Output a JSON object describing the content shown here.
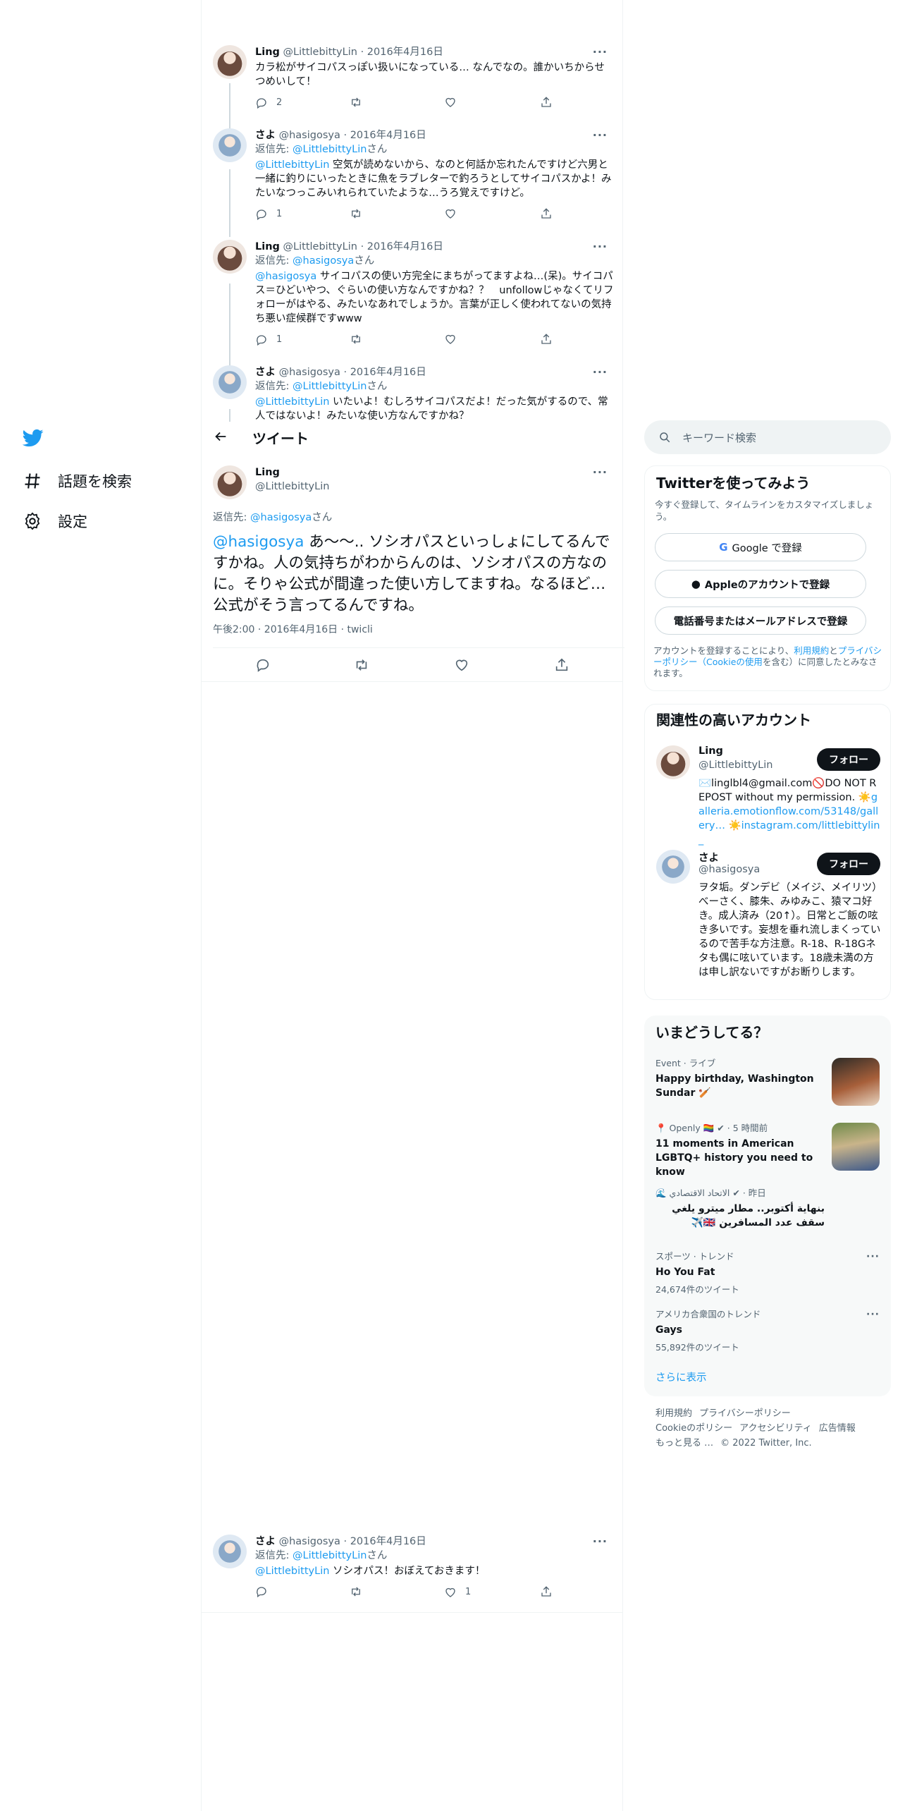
{
  "nav": {
    "explore_label": "話題を検索",
    "settings_label": "設定"
  },
  "thread": [
    {
      "name": "Ling",
      "handle": "@LittlebittyLin",
      "date": "· 2016年4月16日",
      "reply_prefix": "",
      "reply_to": "",
      "reply_suffix": "",
      "mention": "",
      "text": "カラ松がサイコパスっぽい扱いになっている… なんでなの。誰かいちからせつめいして！",
      "replies": "2",
      "retweets": "",
      "likes": ""
    },
    {
      "name": "さよ",
      "handle": "@hasigosya",
      "date": "· 2016年4月16日",
      "reply_prefix": "返信先: ",
      "reply_to": "@LittlebittyLin",
      "reply_suffix": "さん",
      "mention": "@LittlebittyLin",
      "text": " 空気が読めないから、なのと何話か忘れたんですけど六男と一緒に釣りにいったときに魚をラブレターで釣ろうとしてサイコパスかよ！みたいなつっこみいれられていたような…うろ覚えですけど。",
      "replies": "1",
      "retweets": "",
      "likes": ""
    },
    {
      "name": "Ling",
      "handle": "@LittlebittyLin",
      "date": "· 2016年4月16日",
      "reply_prefix": "返信先: ",
      "reply_to": "@hasigosya",
      "reply_suffix": "さん",
      "mention": "@hasigosya",
      "text": " サイコパスの使い方完全にまちがってますよね…(呆)。サイコパス＝ひどいやつ、ぐらいの使い方なんですかね？？　unfollowじゃなくてリフォローがはやる、みたいなあれでしょうか。言葉が正しく使われてないの気持ち悪い症候群ですwww",
      "replies": "1",
      "retweets": "",
      "likes": ""
    },
    {
      "name": "さよ",
      "handle": "@hasigosya",
      "date": "· 2016年4月16日",
      "reply_prefix": "返信先: ",
      "reply_to": "@LittlebittyLin",
      "reply_suffix": "さん",
      "mention": "@LittlebittyLin",
      "text": " いたいよ！むしろサイコパスだよ！だった気がするので、常人ではないよ！みたいな使い方なんですかね？",
      "replies": "",
      "retweets": "",
      "likes": ""
    }
  ],
  "main": {
    "header_title": "ツイート",
    "name": "Ling",
    "handle": "@LittlebittyLin",
    "reply_prefix": "返信先: ",
    "reply_to": "@hasigosya",
    "reply_suffix": "さん",
    "mention": "@hasigosya",
    "text": " あ〜〜.. ソシオパスといっしょにしてるんですかね。人の気持ちがわからんのは、ソシオパスの方なのに。そりゃ公式が間違った使い方してますね。なるほど…公式がそう言ってるんですね。",
    "timestamp": "午後2:00 · 2016年4月16日 · twicli"
  },
  "last_reply": {
    "name": "さよ",
    "handle": "@hasigosya",
    "date": "· 2016年4月16日",
    "reply_prefix": "返信先: ",
    "reply_to": "@LittlebittyLin",
    "reply_suffix": "さん",
    "mention": "@LittlebittyLin",
    "text": " ソシオパス！おぼえておきます！",
    "likes": "1"
  },
  "search": {
    "placeholder": "キーワード検索"
  },
  "signup": {
    "title": "Twitterを使ってみよう",
    "subtitle": "今すぐ登録して、タイムラインをカスタマイズしましょう。",
    "google_label": "Google で登録",
    "apple_label": "Appleのアカウントで登録",
    "phone_label": "電話番号またはメールアドレスで登録",
    "terms_pre": "アカウントを登録することにより、",
    "terms_link1": "利用規約",
    "terms_mid": "と",
    "terms_link2": "プライバシーポリシー（Cookieの使用",
    "terms_post": "を含む）に同意したとみなされます。"
  },
  "related": {
    "title": "関連性の高いアカウント",
    "follow_label": "フォロー",
    "accounts": [
      {
        "name": "Ling",
        "handle": "@LittlebittyLin",
        "bio_a": "✉️linglbl4@gmail.com🚫DO NOT REPOST without my permission. ☀️",
        "bio_link1": "galleria.emotionflow.com/53148/gallery…",
        "bio_b": " ☀️",
        "bio_link2": "instagram.com/littlebittylin_"
      },
      {
        "name": "さよ",
        "handle": "@hasigosya",
        "bio_a": "ヲタ垢。ダンデビ（メイジ、メイリツ）べーさく、膝朱、みゆみこ、猿マコ好き。成人済み（20↑）。日常とご飯の呟き多いです。妄想を垂れ流しまくっているので苦手な方注意。R-18、R-18Gネタも偶に呟いています。18歳未満の方は申し訳ないですがお断りします。",
        "bio_link1": "",
        "bio_b": "",
        "bio_link2": ""
      }
    ]
  },
  "trends": {
    "title": "いまどうしてる？",
    "items": [
      {
        "meta": "Event · ライブ",
        "title": "Happy birthday, Washington Sundar 🏏",
        "count": ""
      },
      {
        "meta": "📍 Openly 🏳️‍🌈 ✔ · 5 時間前",
        "title": "11 moments in American LGBTQ+ history you need to know",
        "count": ""
      },
      {
        "meta": "🌊 الاتحاد الاقتصادي ✔ · 昨日",
        "title": "بنهاية أكتوبر.. مطار ميترو يلغي سقف عدد المسافرين 🇬🇧✈️",
        "count": ""
      },
      {
        "meta": "スポーツ · トレンド",
        "title": "Ho You Fat",
        "count": "24,674件のツイート"
      },
      {
        "meta": "アメリカ合衆国のトレンド",
        "title": "Gays",
        "count": "55,892件のツイート"
      }
    ],
    "show_more": "さらに表示"
  },
  "footer": {
    "links": [
      "利用規約",
      "プライバシーポリシー",
      "Cookieのポリシー",
      "アクセシビリティ",
      "広告情報",
      "もっと見る …"
    ],
    "copyright": "© 2022 Twitter, Inc."
  }
}
